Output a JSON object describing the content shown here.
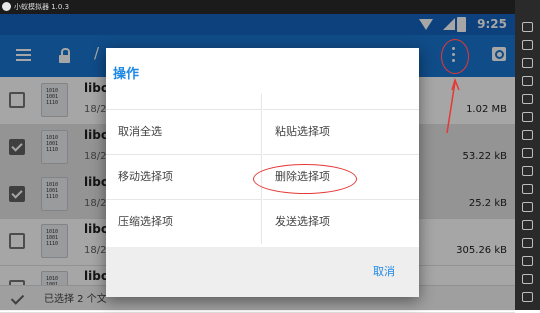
{
  "emulator": {
    "title": "小蚁模拟器 1.0.3"
  },
  "status_bar": {
    "time": "9:25",
    "battery": "⚡"
  },
  "app_bar": {
    "path_fragment": "/"
  },
  "files": [
    {
      "name": "libc.",
      "date": "18/2",
      "size": "1.02 MB",
      "selected": false
    },
    {
      "name": "libc_",
      "date": "18/2",
      "size": "53.22 kB",
      "selected": true
    },
    {
      "name": "libc_",
      "date": "18/2",
      "size": "25.2 kB",
      "selected": true
    },
    {
      "name": "libca",
      "date": "18/2",
      "size": "305.26 kB",
      "selected": false
    },
    {
      "name": "libca",
      "date": "",
      "size": "",
      "selected": false
    }
  ],
  "file_icon_text": "1010\n1001\n1110",
  "bottom_bar": {
    "selection_text": "已选择 2 个文"
  },
  "dialog": {
    "title": "操作",
    "actions": {
      "deselect_all": "取消全选",
      "paste": "粘贴选择项",
      "move": "移动选择项",
      "delete": "删除选择项",
      "compress": "压缩选择项",
      "send": "发送选择项"
    },
    "cancel": "取消"
  },
  "colors": {
    "status_bar": "#1565c0",
    "app_bar": "#1976d2",
    "accent": "#1e88e5",
    "annotation": "#e53935"
  },
  "icons": [
    "menu-icon",
    "lock-icon",
    "more-vert-icon",
    "search-icon",
    "wifi-icon",
    "signal-icon",
    "battery-icon",
    "file-icon",
    "check-icon"
  ]
}
